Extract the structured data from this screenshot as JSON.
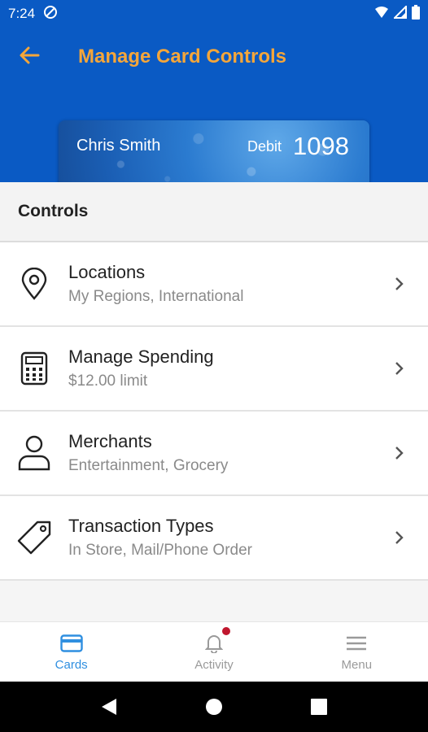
{
  "status_bar": {
    "time": "7:24",
    "icons": [
      "data-saver-icon",
      "wifi-icon",
      "cell-signal-icon",
      "battery-icon"
    ]
  },
  "app_bar": {
    "back_icon": "back-arrow-icon",
    "title": "Manage Card Controls",
    "title_color": "#f5a63a",
    "background": "#0a5ac4"
  },
  "card": {
    "holder_name": "Chris Smith",
    "type": "Debit",
    "last4": "1098"
  },
  "controls": {
    "header": "Controls",
    "items": [
      {
        "icon": "location-pin-icon",
        "title": "Locations",
        "subtitle": "My Regions, International"
      },
      {
        "icon": "calculator-icon",
        "title": "Manage Spending",
        "subtitle": "$12.00 limit"
      },
      {
        "icon": "person-icon",
        "title": "Merchants",
        "subtitle": "Entertainment, Grocery"
      },
      {
        "icon": "tag-icon",
        "title": "Transaction Types",
        "subtitle": "In Store, Mail/Phone Order"
      }
    ]
  },
  "bottom_nav": {
    "items": [
      {
        "icon": "card-icon",
        "label": "Cards",
        "active": true
      },
      {
        "icon": "bell-icon",
        "label": "Activity",
        "active": false
      },
      {
        "icon": "hamburger-menu-icon",
        "label": "Menu",
        "active": false
      }
    ],
    "active_color": "#2f8fe0"
  },
  "system_nav": {
    "icons": [
      "back-triangle-icon",
      "home-circle-icon",
      "recents-square-icon"
    ]
  }
}
